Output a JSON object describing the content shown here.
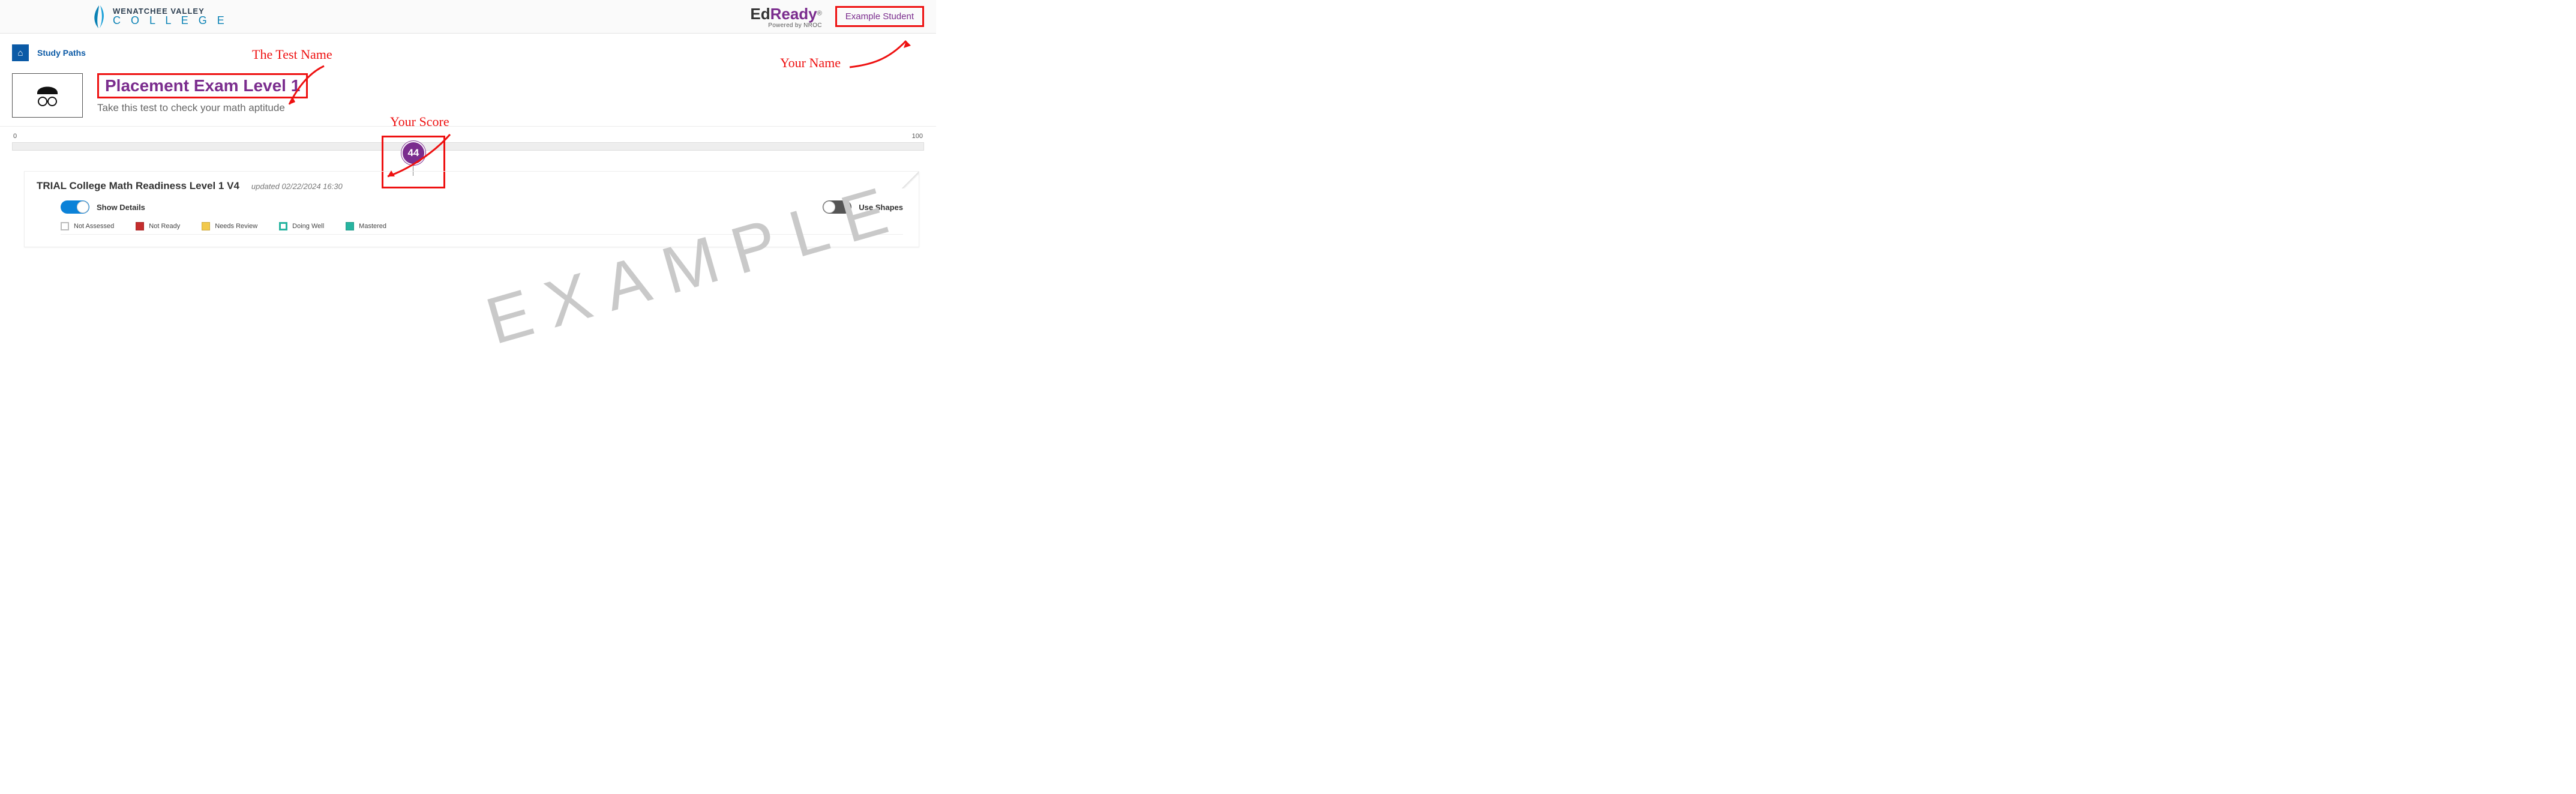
{
  "header": {
    "institution_line1": "WENATCHEE VALLEY",
    "institution_line2": "C O L L E G E",
    "edready_ed": "Ed",
    "edready_ready": "Ready",
    "edready_reg": "®",
    "edready_sub": "Powered by NROC",
    "user_name": "Example Student"
  },
  "breadcrumb": {
    "home_icon": "⌂",
    "study_paths": "Study Paths"
  },
  "exam": {
    "title": "Placement Exam Level 1",
    "subtitle": "Take this test to check your math aptitude"
  },
  "score": {
    "min_label": "0",
    "max_label": "100",
    "value": "44",
    "value_num": 44
  },
  "card": {
    "title": "TRIAL College Math Readiness Level 1 V4",
    "updated": "updated 02/22/2024 16:30",
    "show_details_label": "Show Details",
    "use_shapes_label": "Use Shapes",
    "legend": {
      "not_assessed": "Not Assessed",
      "not_ready": "Not Ready",
      "needs_review": "Needs Review",
      "doing_well": "Doing Well",
      "mastered": "Mastered"
    }
  },
  "annotations": {
    "test_name": "The Test Name",
    "your_score": "Your Score",
    "your_name": "Your Name"
  },
  "watermark": "EXAMPLE"
}
